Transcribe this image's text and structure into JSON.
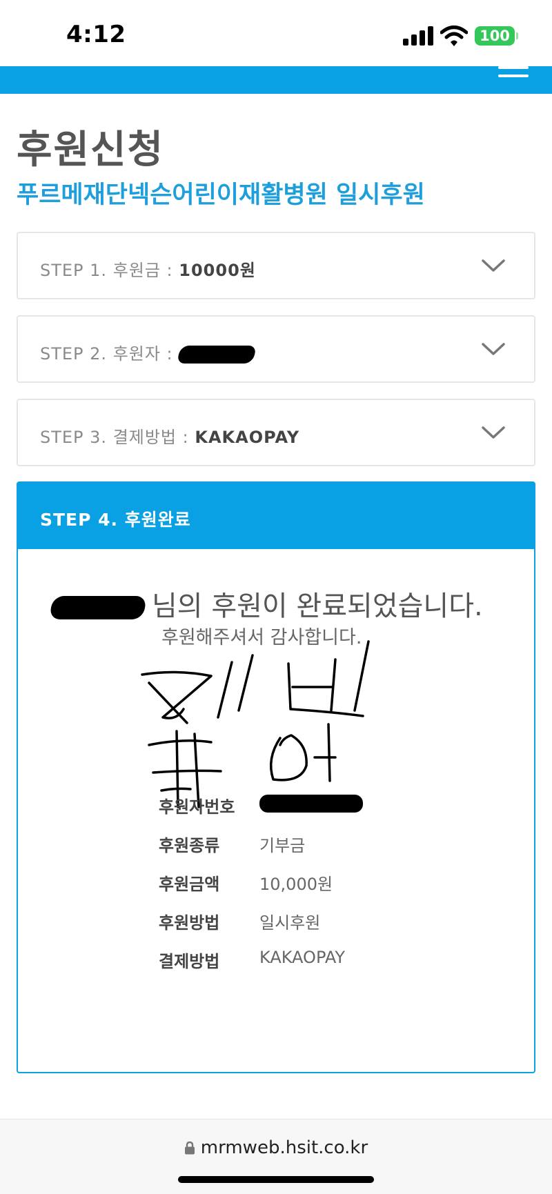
{
  "status": {
    "time": "4:12",
    "battery": "100"
  },
  "page": {
    "title": "후원신청",
    "subtitle": "푸르메재단넥슨어린이재활병원 일시후원"
  },
  "steps": [
    {
      "label": "STEP 1. 후원금 : ",
      "value": "10000원"
    },
    {
      "label": "STEP 2. 후원자 : ",
      "value": ""
    },
    {
      "label": "STEP 3. 결제방법 : ",
      "value": "KAKAOPAY"
    }
  ],
  "step4": {
    "label": "STEP 4. 후원완료",
    "complete_message": "님의 후원이 완료되었습니다.",
    "thanks_message": "후원해주셔서 감사합니다.",
    "info": [
      {
        "key": "후원자번호",
        "value": ""
      },
      {
        "key": "후원종류",
        "value": "기부금"
      },
      {
        "key": "후원금액",
        "value": "10,000원"
      },
      {
        "key": "후원방법",
        "value": "일시후원"
      },
      {
        "key": "결제방법",
        "value": "KAKAOPAY"
      }
    ]
  },
  "browser": {
    "url": "mrmweb.hsit.co.kr"
  },
  "colors": {
    "accent": "#0aa1e4",
    "battery": "#34c759"
  }
}
